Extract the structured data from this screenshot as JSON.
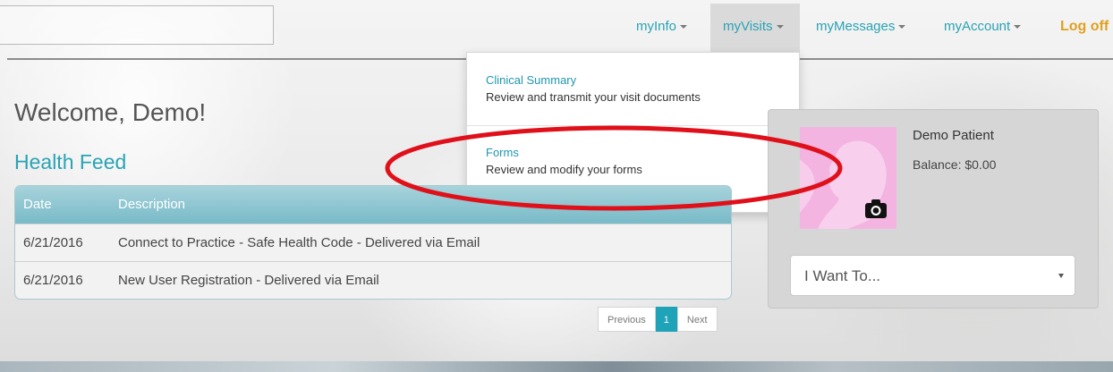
{
  "nav": {
    "items": [
      {
        "label": "myInfo"
      },
      {
        "label": "myVisits"
      },
      {
        "label": "myMessages"
      },
      {
        "label": "myAccount"
      }
    ],
    "logoff": "Log off"
  },
  "dropdown": {
    "items": [
      {
        "title": "Clinical Summary",
        "desc": "Review and transmit your visit documents"
      },
      {
        "title": "Forms",
        "desc": "Review and modify your forms"
      }
    ]
  },
  "welcome": "Welcome, Demo!",
  "feed": {
    "title": "Health Feed",
    "columns": [
      "Date",
      "Description"
    ],
    "rows": [
      {
        "date": "6/21/2016",
        "desc": "Connect to Practice - Safe Health Code - Delivered via Email"
      },
      {
        "date": "6/21/2016",
        "desc": "New User Registration - Delivered via Email"
      }
    ]
  },
  "pager": {
    "prev": "Previous",
    "current": "1",
    "next": "Next"
  },
  "patient": {
    "name": "Demo Patient",
    "balance": "Balance: $0.00",
    "select_value": "I Want To..."
  },
  "colors": {
    "accent": "#2aa3b4",
    "logoff": "#e0a020",
    "annotation": "#e0101a",
    "avatar": "#f4b4e2"
  },
  "icons": {
    "camera": "camera-icon",
    "caret": "caret-down-icon"
  }
}
